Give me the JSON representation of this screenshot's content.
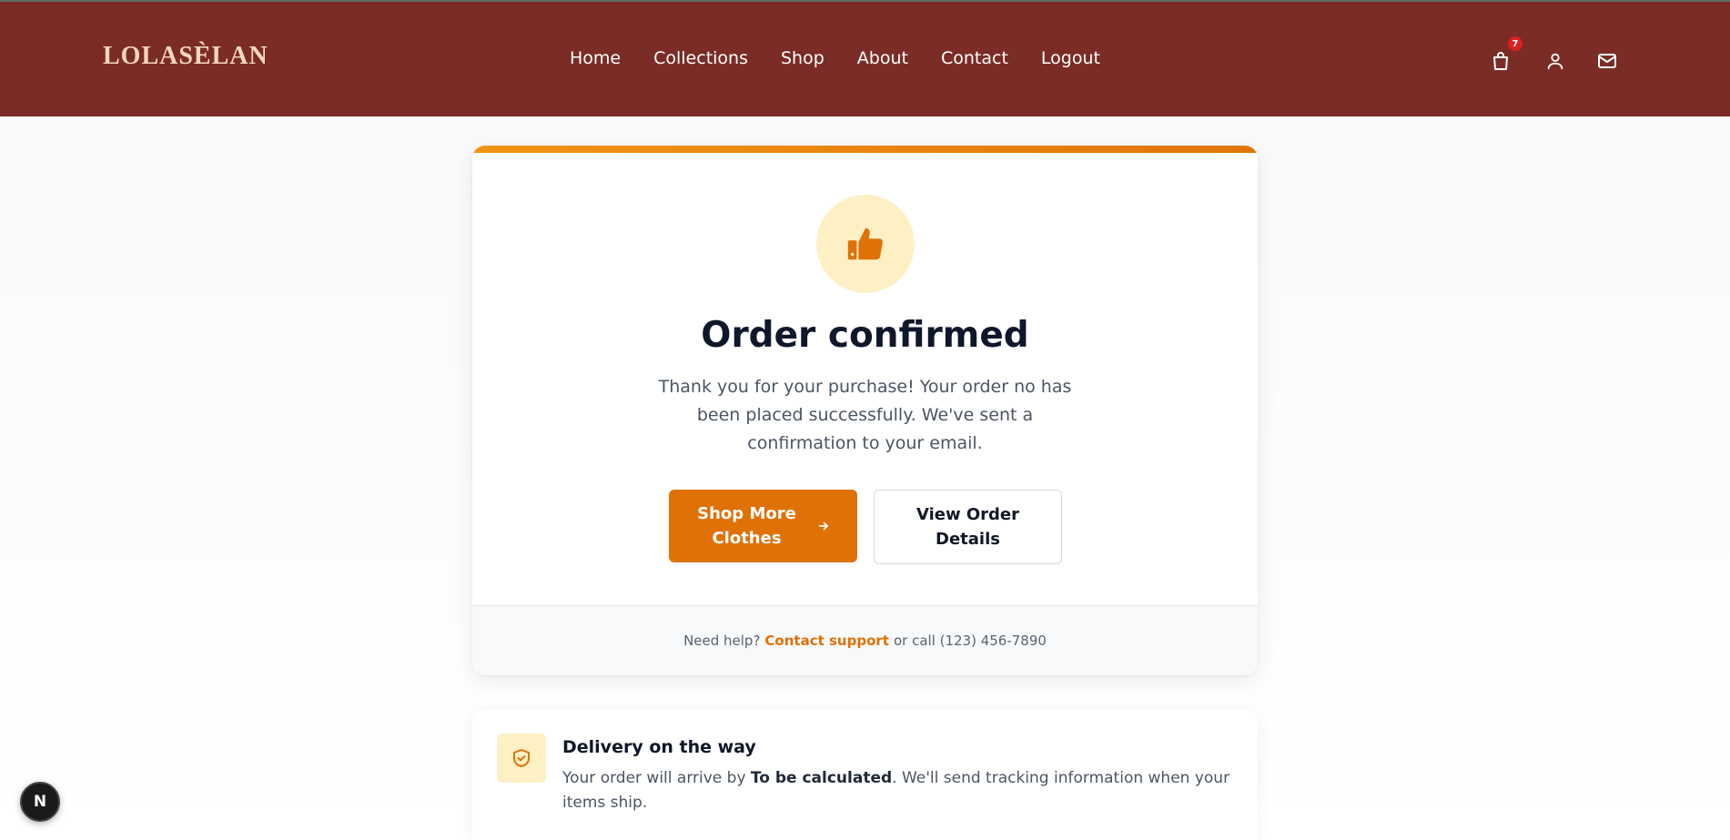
{
  "brand": {
    "logo_text": "LOLASÈLAN"
  },
  "nav": {
    "links": [
      "Home",
      "Collections",
      "Shop",
      "About",
      "Contact",
      "Logout"
    ],
    "cart_count": "7"
  },
  "confirmation": {
    "icon": "thumbs-up-icon",
    "title": "Order confirmed",
    "message": "Thank you for your purchase! Your order no has been placed successfully. We've sent a confirmation to your email.",
    "primary_button": "Shop More Clothes",
    "secondary_button": "View Order Details",
    "help_prefix": "Need help?",
    "help_link": "Contact support",
    "help_suffix": "or call (123) 456-7890"
  },
  "delivery": {
    "icon": "shield-check-icon",
    "title": "Delivery on the way",
    "text_prefix": "Your order will arrive by",
    "arrival": "To be calculated",
    "text_suffix": ". We'll send tracking information when your items ship."
  },
  "dev_badge": "N",
  "colors": {
    "header": "#7b2c26",
    "accent": "#e07107",
    "accent_light": "#fdf0c4",
    "badge": "#e02020"
  }
}
